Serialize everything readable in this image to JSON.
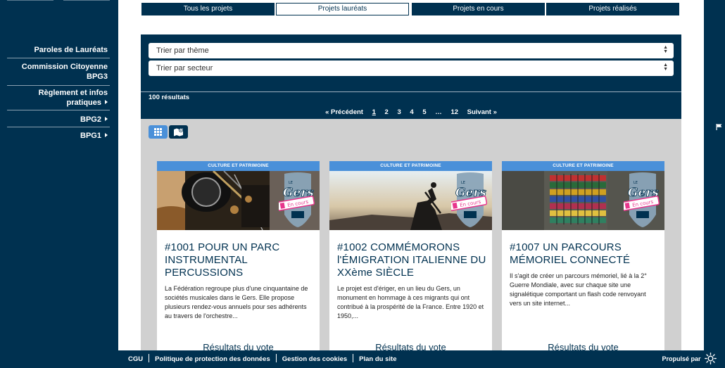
{
  "sidebar": {
    "items": [
      {
        "label": "Paroles de Lauréats",
        "caret": false
      },
      {
        "label": "Commission Citoyenne BPG3",
        "caret": false
      },
      {
        "label": "Règlement et infos pratiques",
        "caret": true
      },
      {
        "label": "BPG2",
        "caret": true
      },
      {
        "label": "BPG1",
        "caret": true
      }
    ]
  },
  "tabs": [
    "Tous les projets",
    "Projets lauréats",
    "Projets en cours",
    "Projets réalisés"
  ],
  "filters": {
    "theme": "Trier par thème",
    "secteur": "Trier par secteur"
  },
  "results": "100 résultats",
  "pagination": {
    "prev": "« Précédent",
    "pages": [
      "1",
      "2",
      "3",
      "4",
      "5",
      "…",
      "12"
    ],
    "next": "Suivant »"
  },
  "badge": {
    "logo": "Gers",
    "sub": "LE",
    "status": "En cours"
  },
  "cards": [
    {
      "category": "CULTURE ET PATRIMOINE",
      "title": "#1001 POUR UN PARC INSTRUMENTAL PERCUSSIONS",
      "text": "La Fédération regroupe plus d'une cinquantaine de sociétés musicales dans le Gers. Elle propose plusieurs rendez-vous annuels pour ses adhérents au travers de l'orchestre...",
      "vote": "Résultats du vote"
    },
    {
      "category": "CULTURE ET PATRIMOINE",
      "title": "#1002 COMMÉMORONS l'ÉMIGRATION ITALIENNE DU XXème SIÈCLE",
      "text": "Le projet est d'ériger, en un lieu du Gers, un monument en hommage à ces migrants qui ont contribué à la prospérité de la France.  Entre 1920 et 1950,...",
      "vote": "Résultats du vote"
    },
    {
      "category": "CULTURE ET PATRIMOINE",
      "title": "#1007 UN PARCOURS MÉMORIEL CONNECTÉ",
      "text": "Il s'agit de créer un parcours mémoriel, lié à la 2° Guerre Mondiale, avec sur chaque site une signalétique comportant un flash code renvoyant vers un site internet...",
      "vote": "Résultats du vote"
    }
  ],
  "footer": {
    "links": [
      "CGU",
      "Politique de protection des données",
      "Gestion des cookies",
      "Plan du site"
    ],
    "powered": "Propulsé par"
  },
  "colors": {
    "navy": "#003150",
    "accent": "#4a90d9",
    "badge_pink": "#e8358c"
  }
}
